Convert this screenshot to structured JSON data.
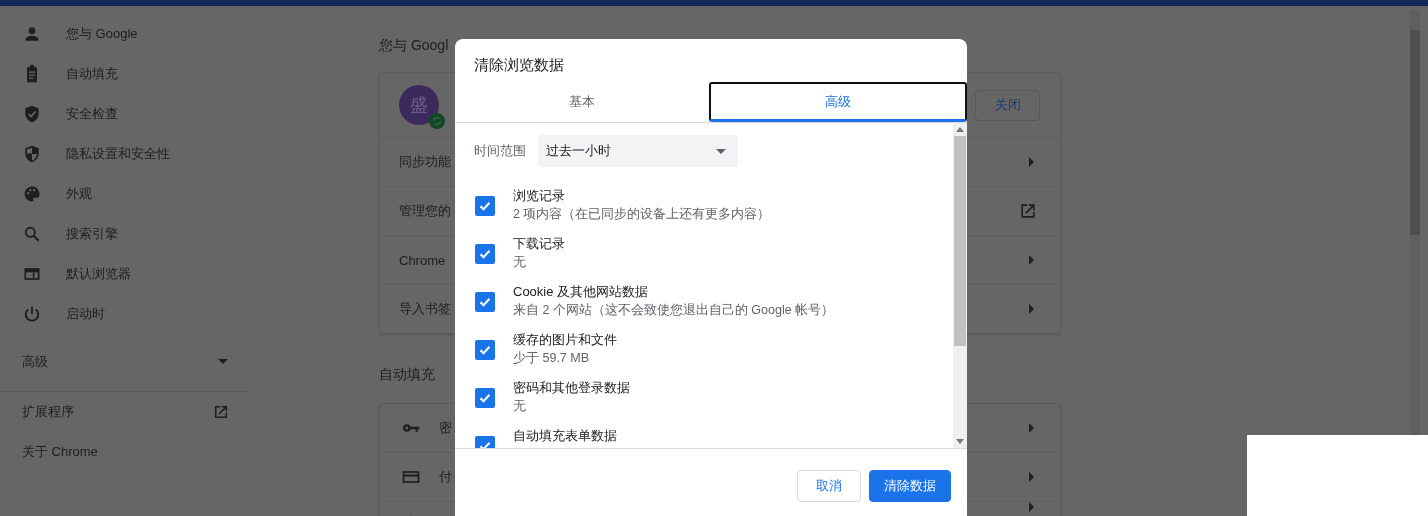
{
  "sidebar": {
    "items": [
      {
        "label": "您与 Google"
      },
      {
        "label": "自动填充"
      },
      {
        "label": "安全检查"
      },
      {
        "label": "隐私设置和安全性"
      },
      {
        "label": "外观"
      },
      {
        "label": "搜索引擎"
      },
      {
        "label": "默认浏览器"
      },
      {
        "label": "启动时"
      }
    ],
    "advanced": {
      "label": "高级",
      "expanded": false
    },
    "extensions": "扩展程序",
    "about": "关于 Chrome"
  },
  "main": {
    "section_title": "您与 Googl",
    "profile": {
      "avatar": "盛",
      "close_button": "关闭"
    },
    "rows": [
      {
        "label": "同步功能"
      },
      {
        "label": "管理您的",
        "kind": "external"
      },
      {
        "label": "Chrome"
      },
      {
        "label": "导入书签"
      }
    ],
    "autofill_title": "自动填充",
    "autofill_rows": [
      {
        "label": "密"
      },
      {
        "label": "付"
      },
      {
        "label": ""
      }
    ]
  },
  "dialog": {
    "title": "清除浏览数据",
    "tabs": [
      {
        "label": "基本",
        "selected": false
      },
      {
        "label": "高级",
        "selected": true
      }
    ],
    "time_range": {
      "label": "时间范围",
      "value": "过去一小时"
    },
    "options": [
      {
        "label": "浏览记录",
        "detail": "2 项内容（在已同步的设备上还有更多内容）",
        "checked": true
      },
      {
        "label": "下载记录",
        "detail": "无",
        "checked": true
      },
      {
        "label": "Cookie 及其他网站数据",
        "detail": "来自 2 个网站（这不会致使您退出自己的 Google 帐号）",
        "checked": true
      },
      {
        "label": "缓存的图片和文件",
        "detail": "少于 59.7 MB",
        "checked": true
      },
      {
        "label": "密码和其他登录数据",
        "detail": "无",
        "checked": true
      },
      {
        "label": "自动填充表单数据",
        "checked": true
      }
    ],
    "buttons": [
      "取消",
      "清除数据"
    ]
  }
}
